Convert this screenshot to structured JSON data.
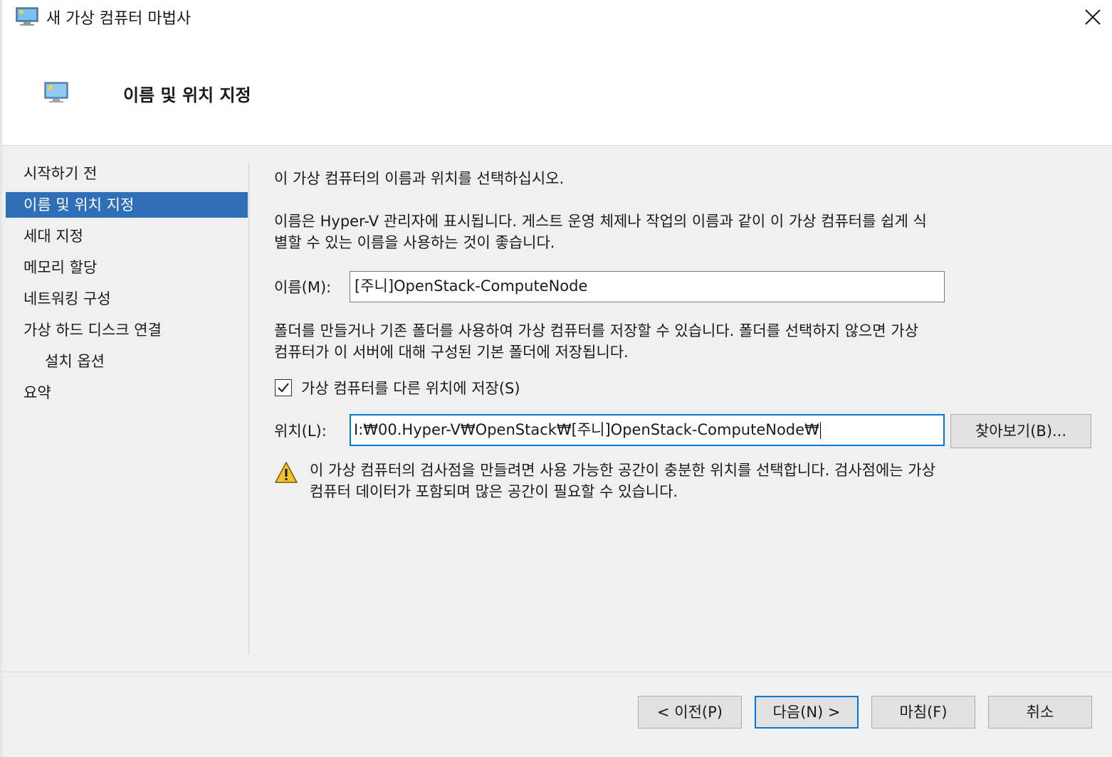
{
  "window": {
    "title": "새 가상 컴퓨터 마법사"
  },
  "header": {
    "title": "이름 및 위치 지정"
  },
  "nav": {
    "items": [
      {
        "label": "시작하기 전"
      },
      {
        "label": "이름 및 위치 지정"
      },
      {
        "label": "세대 지정"
      },
      {
        "label": "메모리 할당"
      },
      {
        "label": "네트워킹 구성"
      },
      {
        "label": "가상 하드 디스크 연결"
      },
      {
        "label": "설치 옵션"
      },
      {
        "label": "요약"
      }
    ],
    "active_index": 1
  },
  "content": {
    "intro": "이 가상 컴퓨터의 이름과 위치를 선택하십시오.",
    "name_help_line1": "이름은 Hyper-V 관리자에 표시됩니다. 게스트 운영 체제나 작업의 이름과 같이 이 가상 컴퓨터를 쉽게 식",
    "name_help_line2": "별할 수 있는 이름을 사용하는 것이 좋습니다.",
    "name_label": "이름(M):",
    "name_value": "[주니]OpenStack-ComputeNode",
    "folder_help_line1": "폴더를 만들거나 기존 폴더를 사용하여 가상 컴퓨터를 저장할 수 있습니다. 폴더를 선택하지 않으면 가상",
    "folder_help_line2": "컴퓨터가 이 서버에 대해 구성된 기본 폴더에 저장됩니다.",
    "store_checkbox_label": "가상 컴퓨터를 다른 위치에 저장(S)",
    "store_checkbox_checked": true,
    "location_label": "위치(L):",
    "location_value": "I:₩00.Hyper-V₩OpenStack₩[주니]OpenStack-ComputeNode₩",
    "browse_label": "찾아보기(B)...",
    "warning_line1": "이 가상 컴퓨터의 검사점을 만들려면 사용 가능한 공간이 충분한 위치를 선택합니다. 검사점에는 가상",
    "warning_line2": "컴퓨터 데이터가 포함되며 많은 공간이 필요할 수 있습니다."
  },
  "footer": {
    "prev_label": "< 이전(P)",
    "next_label": "다음(N) >",
    "finish_label": "마침(F)",
    "cancel_label": "취소"
  },
  "colors": {
    "nav_active_bg": "#2f6fb8",
    "focus_border": "#0078d7",
    "warning_fill": "#f2c12e"
  }
}
